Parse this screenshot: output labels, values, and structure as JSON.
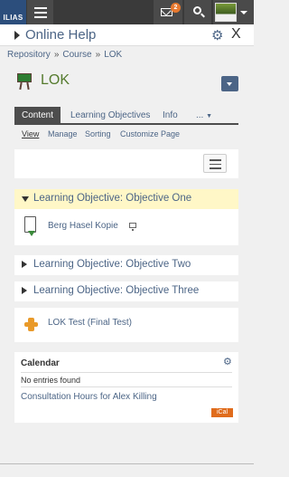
{
  "topbar": {
    "logo_text": "ILIAS",
    "mail_badge": "2"
  },
  "help": {
    "title": "Online Help",
    "close_label": "X"
  },
  "breadcrumb": [
    "Repository",
    "Course",
    "LOK"
  ],
  "page": {
    "title": "LOK"
  },
  "tabs": [
    {
      "label": "Content",
      "active": true
    },
    {
      "label": "Learning Objectives",
      "active": false
    },
    {
      "label": "Info",
      "active": false
    },
    {
      "label": "...",
      "active": false
    }
  ],
  "subtabs": [
    {
      "label": "View",
      "active": true
    },
    {
      "label": "Manage",
      "active": false
    },
    {
      "label": "Sorting",
      "active": false
    },
    {
      "label": "Customize Page",
      "active": false
    }
  ],
  "objectives": [
    {
      "label": "Learning Objective: Objective One",
      "expanded": true,
      "items": [
        {
          "label": "Berg Hasel Kopie"
        }
      ]
    },
    {
      "label": "Learning Objective: Objective Two",
      "expanded": false
    },
    {
      "label": "Learning Objective: Objective Three",
      "expanded": false
    }
  ],
  "test": {
    "label": "LOK Test (Final Test)"
  },
  "calendar": {
    "title": "Calendar",
    "empty_text": "No entries found",
    "link_text": "Consultation Hours for Alex Killing",
    "ical_label": "iCal"
  },
  "colors": {
    "topbar": "#3a3a3a",
    "logo": "#2c4e7c",
    "link": "#4c6586",
    "title_green": "#557b2e",
    "highlight": "#fff7c7",
    "ical": "#e06c1c"
  }
}
